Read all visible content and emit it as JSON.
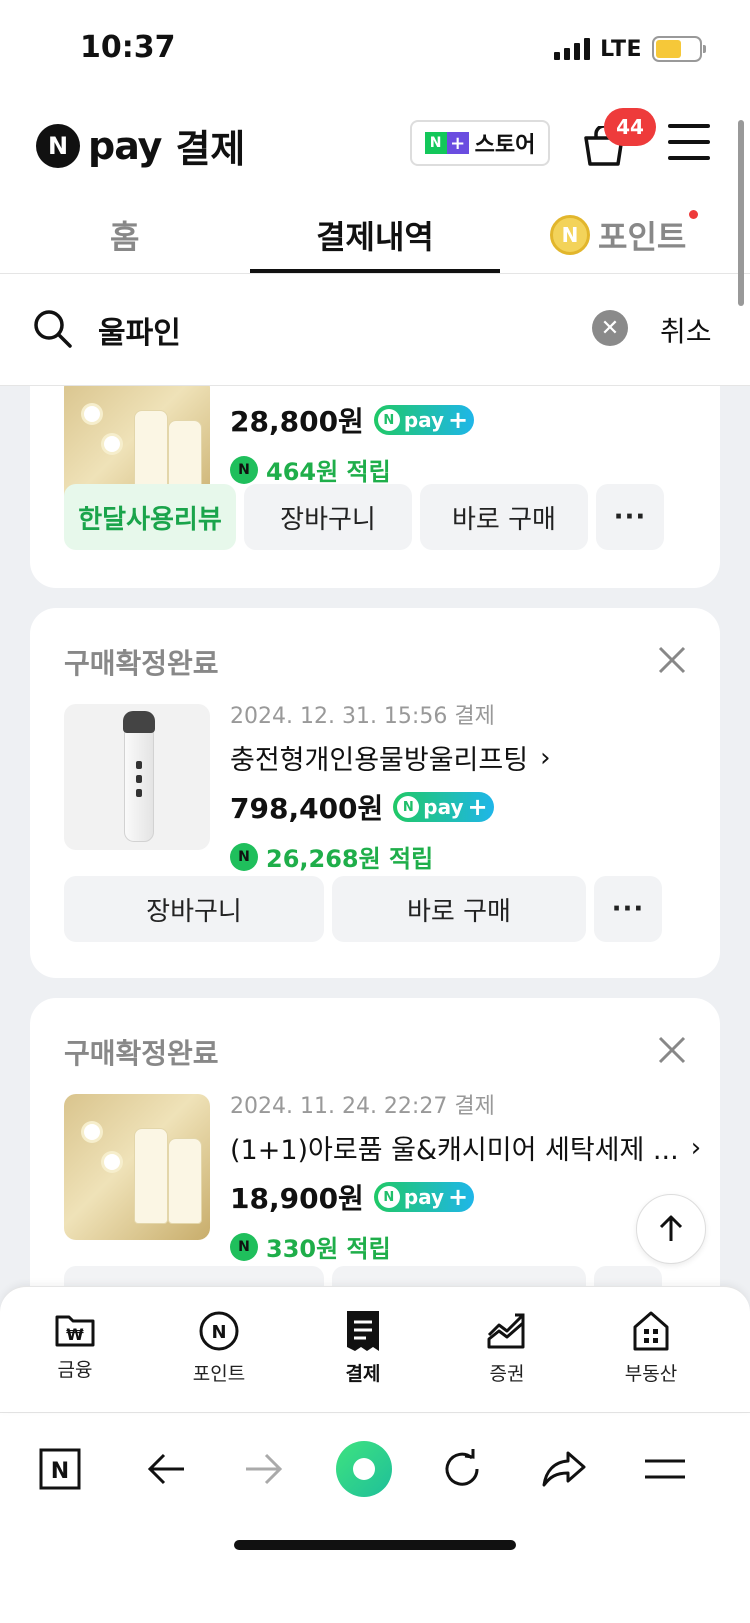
{
  "status_bar": {
    "time": "10:37",
    "network": "LTE"
  },
  "header": {
    "brand": "pay",
    "title": "결제",
    "store_label": "스토어",
    "cart_count": "44"
  },
  "tabs": [
    {
      "label": "홈"
    },
    {
      "label": "결제내역"
    },
    {
      "label": "포인트"
    }
  ],
  "search": {
    "query": "울파인",
    "cancel": "취소"
  },
  "orders": [
    {
      "price": "28,800원",
      "reward": "464원 적립",
      "actions": [
        "한달사용리뷰",
        "장바구니",
        "바로 구매",
        "···"
      ]
    },
    {
      "status": "구매확정완료",
      "date": "2024. 12. 31. 15:56 결제",
      "name": "충전형개인용물방울리프팅",
      "price": "798,400원",
      "reward": "26,268원 적립",
      "actions": [
        "장바구니",
        "바로 구매",
        "···"
      ]
    },
    {
      "status": "구매확정완료",
      "date": "2024. 11. 24. 22:27 결제",
      "name": "(1+1)아로품 울&캐시미어 세탁세제 ...",
      "price": "18,900원",
      "reward": "330원 적립"
    }
  ],
  "npay_badge": "pay",
  "bottom_nav": [
    {
      "label": "금융",
      "icon": "wallet-icon"
    },
    {
      "label": "포인트",
      "icon": "point-coin-icon"
    },
    {
      "label": "결제",
      "icon": "receipt-icon"
    },
    {
      "label": "증권",
      "icon": "stock-chart-icon"
    },
    {
      "label": "부동산",
      "icon": "building-icon"
    }
  ],
  "colors": {
    "accent_green": "#1fae4a",
    "badge_red": "#ee3b3b",
    "review_bg": "#e7f8eb"
  }
}
